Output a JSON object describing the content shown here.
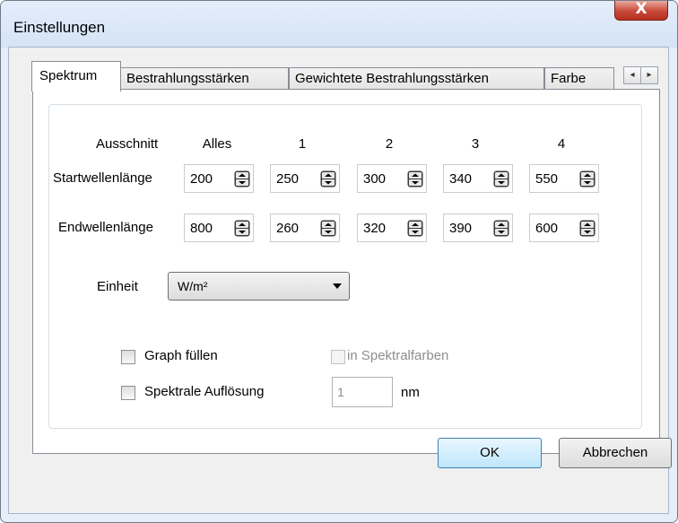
{
  "window": {
    "title": "Einstellungen",
    "close_glyph": "X"
  },
  "tabs": [
    {
      "label": "Spektrum",
      "active": true
    },
    {
      "label": "Bestrahlungsstärken",
      "active": false
    },
    {
      "label": "Gewichtete Bestrahlungsstärken",
      "active": false
    },
    {
      "label": "Farbe",
      "active": false
    }
  ],
  "tab_scroll": {
    "left": "◂",
    "right": "▸"
  },
  "ranges": {
    "header_label": "Ausschnitt",
    "columns": [
      "Alles",
      "1",
      "2",
      "3",
      "4"
    ],
    "start_label": "Startwellenlänge",
    "end_label": "Endwellenlänge",
    "start_values": [
      "200",
      "250",
      "300",
      "340",
      "550"
    ],
    "end_values": [
      "800",
      "260",
      "320",
      "390",
      "600"
    ]
  },
  "unit": {
    "label": "Einheit",
    "value": "W/m²"
  },
  "options": {
    "fill_graph": {
      "label": "Graph füllen",
      "checked": false
    },
    "spectral_colors": {
      "label": "in Spektralfarben",
      "checked": false,
      "enabled": false
    },
    "spectral_resolution": {
      "label": "Spektrale Auflösung",
      "checked": false
    },
    "resolution_value": "1",
    "resolution_unit": "nm"
  },
  "buttons": {
    "ok": "OK",
    "cancel": "Abbrechen"
  },
  "colors": {
    "titlebar": "#dbe7f7",
    "close": "#c8493a",
    "ok_border": "#3c7fb1"
  }
}
